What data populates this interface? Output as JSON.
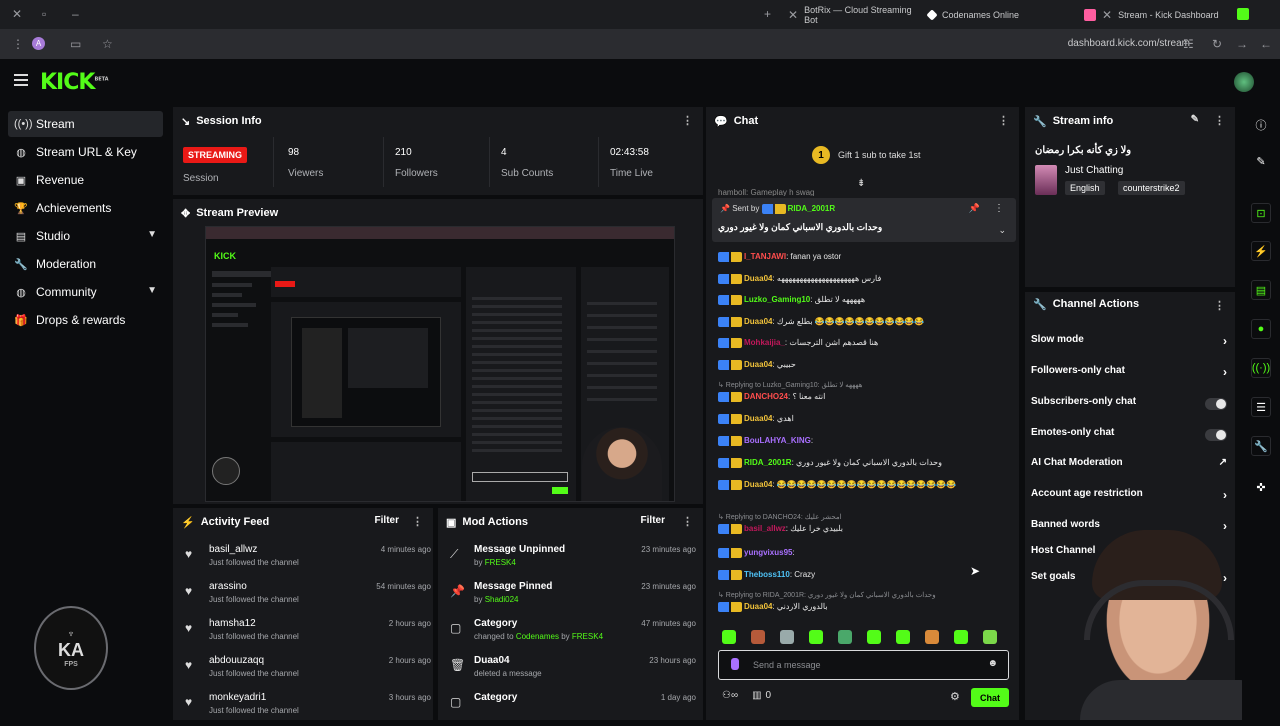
{
  "browser": {
    "tabs": [
      {
        "title": "BotRix — Cloud Streaming Bot"
      },
      {
        "title": "Codenames Online"
      },
      {
        "title": "Stream - Kick Dashboard"
      }
    ],
    "url": "dashboard.kick.com/stream"
  },
  "header": {
    "logo": "KICK",
    "logo_badge": "BETA"
  },
  "sidebar": {
    "items": [
      {
        "label": "Stream",
        "icon": "broadcast-icon"
      },
      {
        "label": "Stream URL & Key",
        "icon": "globe-icon"
      },
      {
        "label": "Revenue",
        "icon": "dollar-icon"
      },
      {
        "label": "Achievements",
        "icon": "trophy-icon"
      },
      {
        "label": "Studio",
        "icon": "studio-icon"
      },
      {
        "label": "Moderation",
        "icon": "wrench-icon"
      },
      {
        "label": "Community",
        "icon": "globe-icon"
      },
      {
        "label": "Drops & rewards",
        "icon": "gift-icon"
      }
    ],
    "logo_text": "KA",
    "logo_sub": "FPS"
  },
  "session": {
    "title": "Session Info",
    "status": "STREAMING",
    "status_label": "Session",
    "stats": [
      {
        "value": "98",
        "label": "Viewers"
      },
      {
        "value": "210",
        "label": "Followers"
      },
      {
        "value": "4",
        "label": "Sub Counts"
      },
      {
        "value": "02:43:58",
        "label": "Time Live"
      }
    ]
  },
  "preview": {
    "title": "Stream Preview"
  },
  "activity": {
    "title": "Activity Feed",
    "filter": "Filter",
    "items": [
      {
        "name": "basil_allwz",
        "action": "Just followed the channel",
        "time": "4 minutes ago"
      },
      {
        "name": "arassino",
        "action": "Just followed the channel",
        "time": "54 minutes ago"
      },
      {
        "name": "hamsha12",
        "action": "Just followed the channel",
        "time": "2 hours ago"
      },
      {
        "name": "abdouuzaqq",
        "action": "Just followed the channel",
        "time": "2 hours ago"
      },
      {
        "name": "monkeyadri1",
        "action": "Just followed the channel",
        "time": "3 hours ago"
      }
    ]
  },
  "mod_actions": {
    "title": "Mod Actions",
    "filter": "Filter",
    "items": [
      {
        "title": "Message Unpinned",
        "detail_prefix": "by",
        "detail": "FRESK4",
        "time": "23 minutes ago"
      },
      {
        "title": "Message Pinned",
        "detail_prefix": "by",
        "detail": "Shadi024",
        "time": "23 minutes ago"
      },
      {
        "title": "Category",
        "detail_prefix": "changed to",
        "detail": "Codenames",
        "detail_suffix_prefix": "by",
        "detail_suffix": "FRESK4",
        "time": "47 minutes ago"
      },
      {
        "title": "Duaa04",
        "detail_prefix": "deleted a message",
        "detail": "",
        "time": "23 hours ago"
      },
      {
        "title": "Category",
        "detail_prefix": "",
        "detail": "",
        "time": "1 day ago"
      }
    ]
  },
  "chat": {
    "title": "Chat",
    "gift_banner": "Gift 1 sub to take 1st",
    "gift_rank": "1",
    "pinned": {
      "label": "Sent by",
      "user": "RIDA_2001R",
      "text": "وحدات بالدوري الاسباني كمان ولا غيور دوري"
    },
    "partial_top": "hamboll: Gameplay h swag",
    "messages": [
      {
        "user": "I_TANJAWI",
        "color": "#ff4d4d",
        "text": "fanan ya ostor"
      },
      {
        "user": "Duaa04",
        "color": "#f0c23b",
        "text": "فارس هههههههههههههههههههههه"
      },
      {
        "user": "Luzko_Gaming10",
        "color": "#53fc18",
        "text": "هههههه لا تطلق"
      },
      {
        "user": "Duaa04",
        "color": "#f0c23b",
        "text": "بطلع شرك 😂😂😂😂😂😂😂😂😂😂😂"
      },
      {
        "user": "Mohkaijia_",
        "color": "#c2185b",
        "text": "هنا قصدهم اشن الترجسات"
      },
      {
        "user": "Duaa04",
        "color": "#f0c23b",
        "text": "حبيبي"
      },
      {
        "user": "DANCHO24",
        "color": "#ff4d4d",
        "text": "انته معنا ؟",
        "reply": "Replying to Luzko_Gaming10: ههههه لا تطلق"
      },
      {
        "user": "Duaa04",
        "color": "#f0c23b",
        "text": "اهدي"
      },
      {
        "user": "BouLAHYA_KING",
        "color": "#a970ff",
        "text": ""
      },
      {
        "user": "RIDA_2001R",
        "color": "#53fc18",
        "text": "وحدات بالدوري الاسباني كمان ولا غيور دوري"
      },
      {
        "user": "Duaa04",
        "color": "#f0c23b",
        "text": "😂😂😂😂😂😂😂😂😂😂😂😂😂😂😂😂😂😂"
      },
      {
        "user": "basil_allwz",
        "color": "#c2185b",
        "text": "بلبيدي خرا عليك",
        "reply": "Replying to DANCHO24: امحشر عليك"
      },
      {
        "user": "yungvixus95",
        "color": "#a970ff",
        "text": ""
      },
      {
        "user": "Theboss110",
        "color": "#4fc3f7",
        "text": "Crazy"
      },
      {
        "user": "Duaa04",
        "color": "#f0c23b",
        "text": "بالدوري الاردني",
        "reply": "Replying to RIDA_2001R: وحدات بالدوري الاسباني كمان ولا غيور دوري"
      }
    ],
    "input_placeholder": "Send a message",
    "viewer_count": "0",
    "send_label": "Chat"
  },
  "stream_info": {
    "title": "Stream info",
    "stream_title": "ولا زي كأنه بكرا رمضان",
    "category": "Just Chatting",
    "tags": [
      "English",
      "counterstrike2"
    ]
  },
  "channel_actions": {
    "title": "Channel Actions",
    "items": [
      {
        "label": "Slow mode",
        "control": "chevron"
      },
      {
        "label": "Followers-only chat",
        "control": "chevron"
      },
      {
        "label": "Subscribers-only chat",
        "control": "toggle"
      },
      {
        "label": "Emotes-only chat",
        "control": "toggle"
      },
      {
        "label": "AI Chat Moderation",
        "control": "external"
      },
      {
        "label": "Account age restriction",
        "control": "chevron"
      },
      {
        "label": "Banned words",
        "control": "chevron"
      },
      {
        "label": "Host Channel",
        "control": "none"
      },
      {
        "label": "Set goals",
        "control": "chevron"
      }
    ]
  },
  "colors": {
    "accent": "#53fc18",
    "live": "#e91916",
    "panel": "#18191c",
    "background": "#0b0c0e"
  }
}
